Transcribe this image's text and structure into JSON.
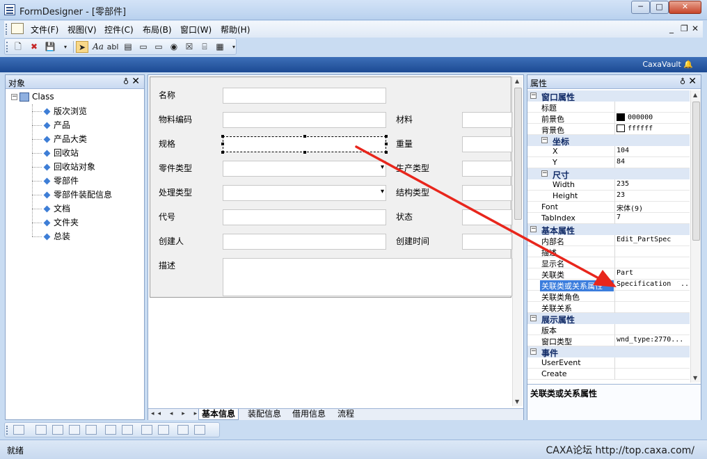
{
  "window": {
    "title": "FormDesigner - [零部件]",
    "min": "─",
    "max": "□",
    "close": "✕"
  },
  "menu": {
    "items": [
      "文件(F)",
      "视图(V)",
      "控件(C)",
      "布局(B)",
      "窗口(W)",
      "帮助(H)"
    ],
    "mdi_min": "_",
    "mdi_restore": "❐",
    "mdi_close": "✕"
  },
  "toolbar": {
    "buttons": [
      "new",
      "delete",
      "save",
      "pointer",
      "label",
      "textbox",
      "listbox",
      "button",
      "line",
      "radio",
      "checkbox",
      "groupbox",
      "grid"
    ]
  },
  "band": {
    "text": "CaxaVault"
  },
  "objects_panel": {
    "title": "对象",
    "pin": "♁",
    "close": "✕",
    "root": "Class",
    "items": [
      "版次浏览",
      "产品",
      "产品大类",
      "回收站",
      "回收站对象",
      "零部件",
      "零部件装配信息",
      "文档",
      "文件夹",
      "总装"
    ]
  },
  "form": {
    "fields": [
      {
        "label": "名称"
      },
      {
        "label": "物料编码"
      },
      {
        "label": "规格"
      },
      {
        "label": "零件类型"
      },
      {
        "label": "处理类型"
      },
      {
        "label": "代号"
      },
      {
        "label": "创建人"
      },
      {
        "label": "描述"
      }
    ],
    "right_fields": [
      "材料",
      "重量",
      "生产类型",
      "结构类型",
      "状态",
      "创建时间"
    ],
    "tabs": [
      "基本信息",
      "装配信息",
      "借用信息",
      "流程"
    ],
    "nav": "◂◂ ◂ ▸ ▸▸"
  },
  "properties_panel": {
    "title": "属性",
    "pin": "♁",
    "close": "✕",
    "categories": {
      "window": "窗口属性",
      "coord": "坐标",
      "size": "尺寸",
      "basic": "基本属性",
      "display": "展示属性",
      "events": "事件"
    },
    "rows": {
      "title": {
        "name": "标题",
        "value": ""
      },
      "fg": {
        "name": "前景色",
        "value": "000000",
        "color": "#000000"
      },
      "bg": {
        "name": "背景色",
        "value": "ffffff",
        "color": "#ffffff"
      },
      "x": {
        "name": "X",
        "value": "104"
      },
      "y": {
        "name": "Y",
        "value": "84"
      },
      "width": {
        "name": "Width",
        "value": "235"
      },
      "height": {
        "name": "Height",
        "value": "23"
      },
      "font": {
        "name": "Font",
        "value": "宋体(9)"
      },
      "tabindex": {
        "name": "TabIndex",
        "value": "7"
      },
      "inner_name": {
        "name": "内部名",
        "value": "Edit_PartSpec"
      },
      "desc": {
        "name": "描述",
        "value": ""
      },
      "display_name": {
        "name": "显示名",
        "value": ""
      },
      "rel_class": {
        "name": "关联类",
        "value": "Part"
      },
      "rel_attr": {
        "name": "关联类或关系属性",
        "value": "Specification",
        "ellipsis": "..."
      },
      "rel_role": {
        "name": "关联类角色",
        "value": ""
      },
      "relation": {
        "name": "关联关系",
        "value": ""
      },
      "version": {
        "name": "版本",
        "value": ""
      },
      "wnd_type": {
        "name": "窗口类型",
        "value": "wnd_type:2770..."
      },
      "user_event": {
        "name": "UserEvent",
        "value": ""
      },
      "create": {
        "name": "Create",
        "value": ""
      }
    },
    "description_title": "关联类或关系属性"
  },
  "status": {
    "text": "就绪",
    "watermark": "CAXA论坛 http://top.caxa.com/"
  },
  "colors": {
    "accent": "#3b7ddd",
    "band": "#1c4a93",
    "arrow": "#e8261c"
  }
}
